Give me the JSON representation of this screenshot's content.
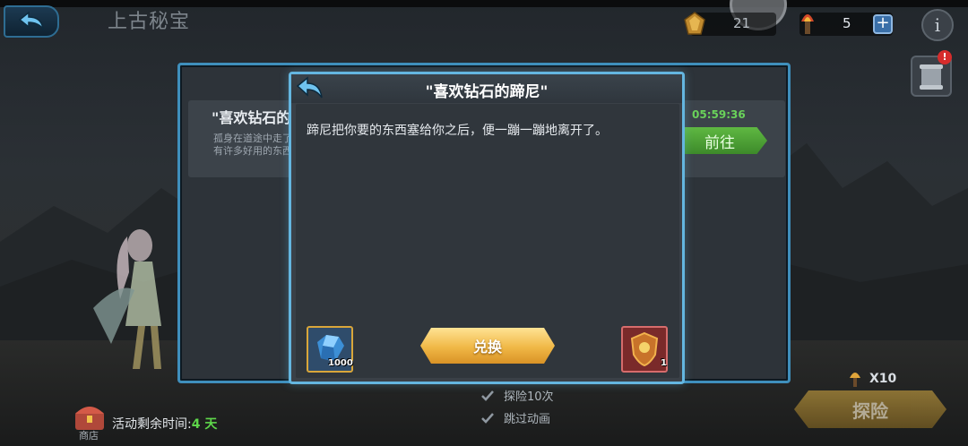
{
  "top_bar": {
    "title": "上古秘宝",
    "resources": {
      "gem_value": "21",
      "fuel_value": "5"
    }
  },
  "event_panel": {
    "card": {
      "title": "\"喜欢钻石的",
      "description_line1": "孤身在道途中走了",
      "description_line2": "有许多好用的东西",
      "timer": "05:59:36",
      "goto_label": "前往"
    }
  },
  "dialog": {
    "title": "\"喜欢钻石的蹄尼\"",
    "message": "蹄尼把你要的东西塞给你之后，便一蹦一蹦地离开了。",
    "exchange_label": "兑换",
    "give_item": {
      "icon": "diamond-icon",
      "count": "1000",
      "color": "#4aa8e8"
    },
    "receive_item": {
      "icon": "shield-icon",
      "count": "1",
      "color": "#c8732a"
    }
  },
  "bottom": {
    "options": [
      {
        "label": "探险10次",
        "checked": true
      },
      {
        "label": "跳过动画",
        "checked": true
      }
    ],
    "shop_label": "商店",
    "event_remaining_prefix": "活动剩余时间:",
    "event_remaining_days": "4 天",
    "multiplier_label": "X10",
    "explore_label": "探险"
  }
}
